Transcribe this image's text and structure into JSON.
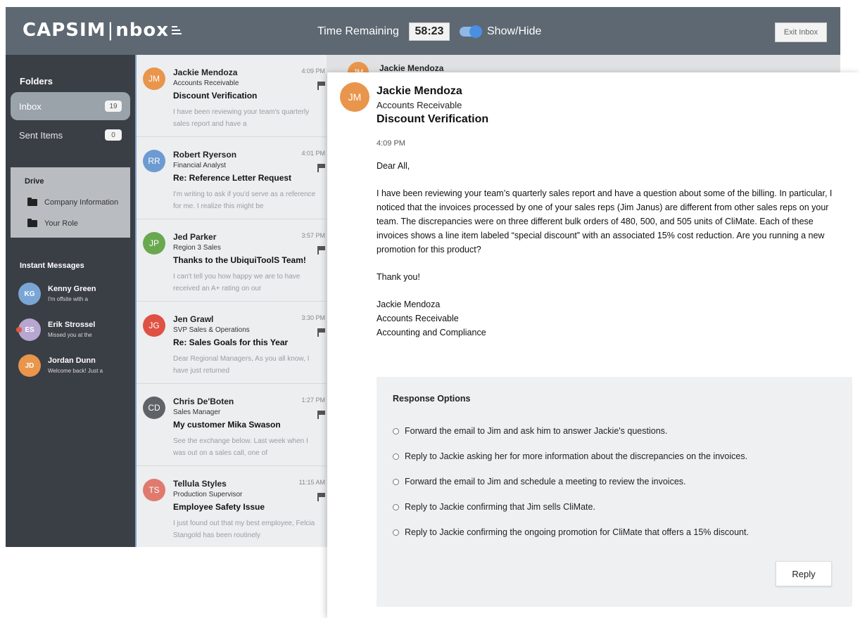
{
  "header": {
    "logo_left": "CAPSIM",
    "logo_sep": "|",
    "logo_right": "nbox",
    "timer_label": "Time Remaining",
    "timer_value": "58:23",
    "show_hide_label": "Show/Hide",
    "exit_label": "Exit Inbox"
  },
  "sidebar": {
    "folders_title": "Folders",
    "folders": [
      {
        "label": "Inbox",
        "count": "19"
      },
      {
        "label": "Sent Items",
        "count": "0"
      }
    ],
    "drive_title": "Drive",
    "drive_items": [
      {
        "label": "Company Information"
      },
      {
        "label": "Your Role"
      }
    ],
    "im_title": "Instant Messages",
    "im": [
      {
        "initials": "KG",
        "name": "Kenny Green",
        "preview": "I'm offsite with a",
        "color": "#7aa6d6"
      },
      {
        "initials": "ES",
        "name": "Erik Strossel",
        "preview": "Missed you at the",
        "color": "#b7a6cf"
      },
      {
        "initials": "JD",
        "name": "Jordan Dunn",
        "preview": "Welcome back! Just a",
        "color": "#e9954c"
      }
    ]
  },
  "messages": [
    {
      "initials": "JM",
      "color": "#e9954c",
      "name": "Jackie Mendoza",
      "role": "Accounts Receivable",
      "subject": "Discount Verification",
      "time": "4:09 PM",
      "preview": "I have been reviewing your team's quarterly sales report and have a"
    },
    {
      "initials": "RR",
      "color": "#6d9bd1",
      "name": "Robert Ryerson",
      "role": "Financial Analyst",
      "subject": "Re: Reference Letter Request",
      "time": "4:01 PM",
      "preview": "I'm writing to ask if you'd serve as a reference for me. I realize this might be"
    },
    {
      "initials": "JP",
      "color": "#6aa84f",
      "name": "Jed Parker",
      "role": "Region 3 Sales",
      "subject": "Thanks to the UbiquiToolS Team!",
      "time": "3:57 PM",
      "preview": "I can't tell you how happy we are to have received an A+ rating on our"
    },
    {
      "initials": "JG",
      "color": "#df5142",
      "name": "Jen Grawl",
      "role": "SVP Sales & Operations",
      "subject": "Re: Sales Goals for this Year",
      "time": "3:30 PM",
      "preview": "Dear Regional Managers, As you all know, I have just returned"
    },
    {
      "initials": "CD",
      "color": "#5f6368",
      "name": "Chris De'Boten",
      "role": "Sales Manager",
      "subject": "My customer Mika Swason",
      "time": "1:27 PM",
      "preview": "See the exchange below. Last week when I was out on a sales call, one of"
    },
    {
      "initials": "TS",
      "color": "#e07a6e",
      "name": "Tellula Styles",
      "role": "Production Supervisor",
      "subject": "Employee Safety Issue",
      "time": "11:15 AM",
      "preview": "I just found out that my best employee, Felcia Stangold has been routinely"
    }
  ],
  "behind": {
    "initials": "JM",
    "name": "Jackie Mendoza"
  },
  "email": {
    "initials": "JM",
    "name": "Jackie Mendoza",
    "role": "Accounts Receivable",
    "subject": "Discount Verification",
    "time": "4:09 PM",
    "greeting": "Dear All,",
    "body": "I have been reviewing your team’s quarterly sales report and have a question about some of the billing. In particular, I noticed that the invoices processed by one of your sales reps (Jim Janus) are different from other sales reps on your team. The discrepancies were on three different bulk orders of 480, 500, and 505 units of CliMate. Each of these invoices shows a line item labeled “special discount” with an associated 15% cost reduction. Are you running a new promotion for this product?",
    "thanks": "Thank you!",
    "sig_name": "Jackie Mendoza",
    "sig_role": "Accounts Receivable",
    "sig_dept": "Accounting and Compliance"
  },
  "response": {
    "title": "Response Options",
    "options": [
      "Forward the email to Jim and ask him to answer Jackie's questions.",
      "Reply to Jackie asking her for more information about the discrepancies on the invoices.",
      "Forward the email to Jim and schedule a meeting to review the invoices.",
      "Reply to Jackie confirming that Jim sells CliMate.",
      "Reply to Jackie confirming the ongoing promotion for CliMate that offers a 15% discount."
    ],
    "reply_label": "Reply"
  }
}
